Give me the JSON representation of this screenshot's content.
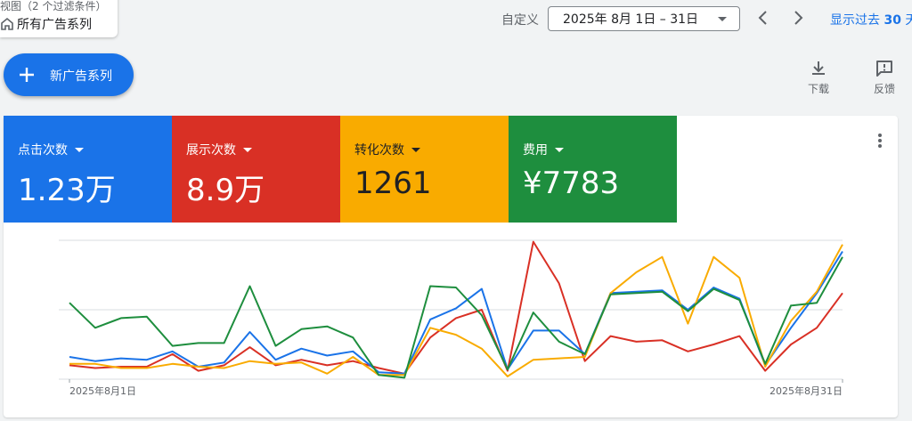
{
  "header": {
    "view_filter": "视图（2 个过滤条件）",
    "view_name": "所有广告系列",
    "custom_label": "自定义",
    "date_range": "2025年 8月 1日 – 31日",
    "show_last_prefix": "显示过去 ",
    "show_last_number": "30",
    "show_last_suffix": " 天"
  },
  "actions": {
    "new_campaign": "新广告系列",
    "download": "下载",
    "feedback": "反馈"
  },
  "metrics": [
    {
      "label": "点击次数",
      "value": "1.23万",
      "color": "#1a73e8"
    },
    {
      "label": "展示次数",
      "value": "8.9万",
      "color": "#d93025"
    },
    {
      "label": "转化次数",
      "value": "1261",
      "color": "#f9ab00"
    },
    {
      "label": "费用",
      "value": "¥7783",
      "color": "#1e8e3e"
    }
  ],
  "chart_data": {
    "type": "line",
    "x_tick_labels": [
      "2025年8月1日",
      "2025年8月31日"
    ],
    "x": [
      1,
      2,
      3,
      4,
      5,
      6,
      7,
      8,
      9,
      10,
      11,
      12,
      13,
      14,
      15,
      16,
      17,
      18,
      19,
      20,
      21,
      22,
      23,
      24,
      25,
      26,
      27,
      28,
      29,
      30,
      31
    ],
    "ylim": [
      0,
      100
    ],
    "grid": true,
    "series": [
      {
        "color": "#1a73e8",
        "values": [
          16,
          13,
          15,
          14,
          20,
          9,
          12,
          34,
          14,
          22,
          17,
          20,
          5,
          4,
          43,
          51,
          65,
          7,
          35,
          35,
          18,
          62,
          63,
          64,
          50,
          66,
          58,
          10,
          37,
          62,
          92
        ]
      },
      {
        "color": "#d93025",
        "values": [
          10,
          8,
          9,
          9,
          18,
          6,
          10,
          23,
          10,
          14,
          10,
          13,
          8,
          4,
          30,
          44,
          50,
          6,
          99,
          69,
          13,
          31,
          27,
          28,
          20,
          25,
          31,
          6,
          25,
          37,
          62
        ]
      },
      {
        "color": "#f9ab00",
        "values": [
          11,
          11,
          8,
          8,
          11,
          9,
          8,
          13,
          11,
          12,
          4,
          16,
          3,
          3,
          37,
          32,
          22,
          2,
          14,
          15,
          16,
          62,
          77,
          88,
          40,
          88,
          73,
          9,
          42,
          63,
          97
        ]
      },
      {
        "color": "#1e8e3e",
        "values": [
          55,
          37,
          44,
          45,
          24,
          26,
          26,
          67,
          24,
          36,
          38,
          30,
          3,
          1,
          67,
          66,
          46,
          7,
          48,
          27,
          18,
          61,
          62,
          63,
          49,
          65,
          57,
          11,
          53,
          55,
          88
        ]
      }
    ]
  }
}
